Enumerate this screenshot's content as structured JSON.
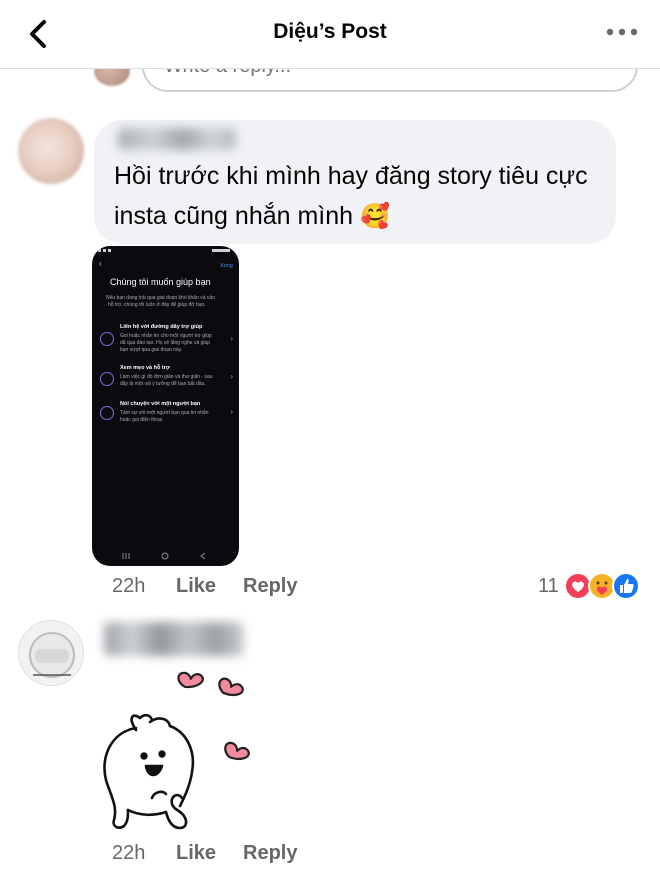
{
  "header": {
    "title": "Diệu’s Post",
    "back_icon": "chevron-left-icon",
    "more_icon": "more-horizontal-icon"
  },
  "reply_box": {
    "placeholder": "Write a reply..."
  },
  "comments": [
    {
      "text_line1": "Hồi trước khi mình hay đăng story tiêu cực",
      "text_line2": "insta cũng nhắn mình",
      "emoji": "🥰",
      "screenshot": {
        "done_label": "Xong",
        "heading": "Chúng tôi muốn giúp bạn",
        "intro_line1": "Nếu bạn đang trải qua giai đoạn khó khăn và cần",
        "intro_line2": "hỗ trợ, chúng tôi luôn ở đây để giúp đỡ bạn.",
        "options": [
          {
            "title": "Liên hệ với đường dây trợ giúp",
            "line1": "Gọi hoặc nhắn tin cho một người trợ giúp",
            "line2": "đã qua đào tạo. Họ sẽ lắng nghe và giúp",
            "line3": "bạn vượt qua giai đoạn này."
          },
          {
            "title": "Xem mẹo và hỗ trợ",
            "line1": "Làm việc gì đó đơn giản và thư giãn - sau",
            "line2": "đây là một vài ý tưởng để bạn bắt đầu.",
            "line3": ""
          },
          {
            "title": "Nói chuyện với một người bạn",
            "line1": "Tâm sự với một người bạn qua tin nhắn",
            "line2": "hoặc gọi điện thoại.",
            "line3": ""
          }
        ]
      },
      "time": "22h",
      "like_label": "Like",
      "reply_label": "Reply",
      "reaction_count": "11",
      "reaction_icons": [
        "love-reaction-icon",
        "care-reaction-icon",
        "like-reaction-icon"
      ]
    },
    {
      "sticker": "bunny-sticker-with-hearts",
      "time": "22h",
      "like_label": "Like",
      "reply_label": "Reply"
    }
  ],
  "colors": {
    "bubble": "#f0f2f5",
    "meta_text": "#65676b",
    "love_red": "#f33e58",
    "like_blue": "#1877f2",
    "care_yellow": "#f7b125",
    "heart_pink": "#f08a9c"
  }
}
